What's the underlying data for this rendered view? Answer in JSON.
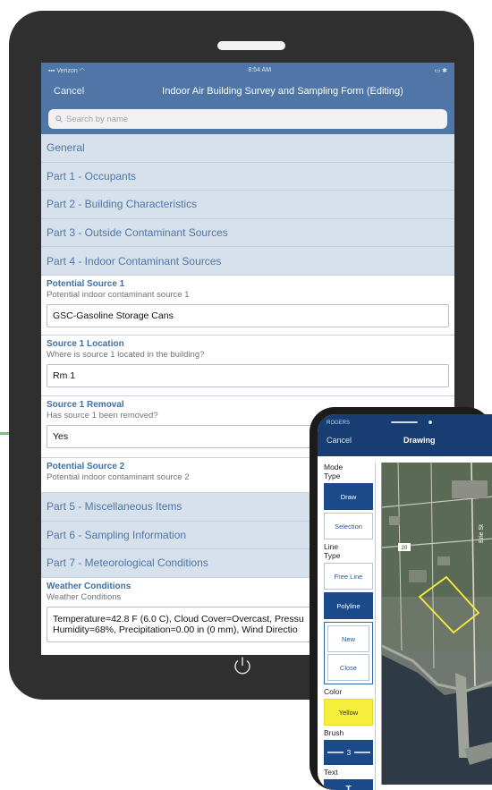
{
  "tablet": {
    "status": {
      "carrier": "Verizon",
      "time": "8:54 AM"
    },
    "nav": {
      "cancel": "Cancel",
      "title": "Indoor Air Building Survey and Sampling Form (Editing)"
    },
    "search": {
      "placeholder": "Search by name"
    },
    "sections_top": [
      "General",
      "Part 1 - Occupants",
      "Part 2 - Building Characteristics",
      "Part 3 - Outside Contaminant Sources",
      "Part 4 - Indoor Contaminant Sources"
    ],
    "fields": [
      {
        "label": "Potential Source 1",
        "sub": "Potential indoor contaminant source 1",
        "value": "GSC-Gasoline Storage Cans"
      },
      {
        "label": "Source 1 Location",
        "sub": "Where is source 1 located in the building?",
        "value": "Rm 1"
      },
      {
        "label": "Source 1 Removal",
        "sub": "Has source 1 been removed?",
        "value": "Yes"
      },
      {
        "label": "Potential Source 2",
        "sub": "Potential indoor contaminant source 2"
      }
    ],
    "sections_bottom": [
      "Part 5 - Miscellaneous Items",
      "Part 6 - Sampling Information",
      "Part 7 - Meteorological Conditions"
    ],
    "weather": {
      "label": "Weather Conditions",
      "sub": "Weather Conditions",
      "line1": "Temperature=42.8 F (6.0 C), Cloud Cover=Overcast, Pressu",
      "line2": "Humidity=68%, Precipitation=0.00 in (0 mm), Wind Directio"
    }
  },
  "phone": {
    "status": "ROGERS",
    "cancel": "Cancel",
    "title": "Drawing",
    "mode_label": "Mode",
    "type_label": "Type",
    "draw": "Draw",
    "selection": "Selection",
    "line_label": "Line",
    "line_type_label": "Type",
    "free_line": "Free Line",
    "polyline": "Polyline",
    "new": "New",
    "close": "Close",
    "color_label": "Color",
    "color_value": "Yellow",
    "brush_label": "Brush",
    "brush_value": "3",
    "text_label": "Text",
    "map_route": "20",
    "map_street": "Erie St"
  },
  "colors": {
    "header": "#4f76a6",
    "section": "#d6e1ec",
    "phone_header": "#173d72",
    "accent_yellow": "#f5ee3a"
  }
}
